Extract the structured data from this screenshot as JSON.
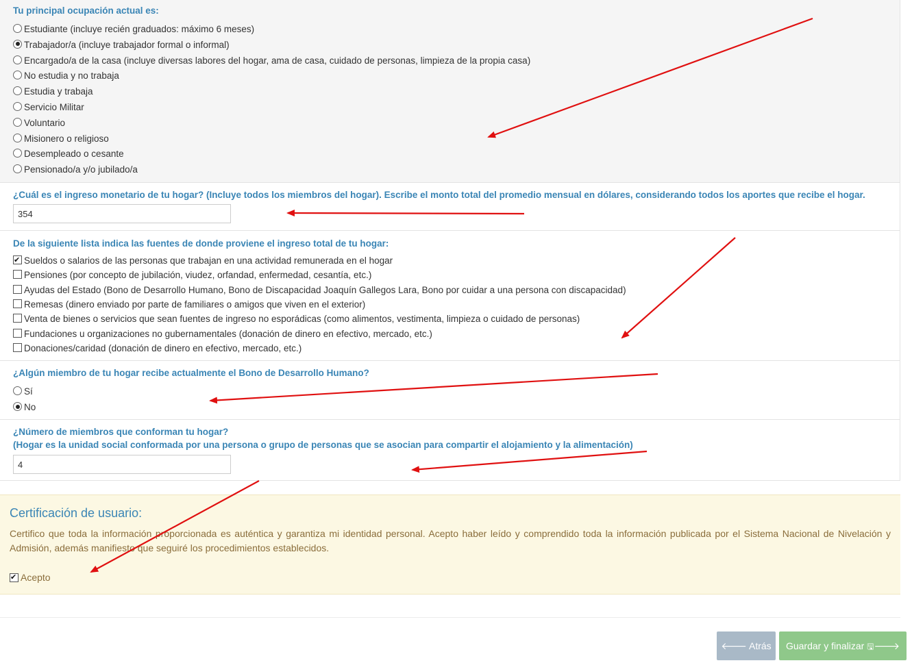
{
  "occupation": {
    "title": "Tu principal ocupación actual es:",
    "options": [
      {
        "label": "Estudiante (incluye recién graduados: máximo 6 meses)",
        "selected": false
      },
      {
        "label": "Trabajador/a (incluye trabajador formal o informal)",
        "selected": true
      },
      {
        "label": "Encargado/a de la casa (incluye diversas labores del hogar, ama de casa, cuidado de personas, limpieza de la propia casa)",
        "selected": false
      },
      {
        "label": "No estudia y no trabaja",
        "selected": false
      },
      {
        "label": "Estudia y trabaja",
        "selected": false
      },
      {
        "label": "Servicio Militar",
        "selected": false
      },
      {
        "label": "Voluntario",
        "selected": false
      },
      {
        "label": "Misionero o religioso",
        "selected": false
      },
      {
        "label": "Desempleado o cesante",
        "selected": false
      },
      {
        "label": "Pensionado/a y/o jubilado/a",
        "selected": false
      }
    ]
  },
  "income": {
    "title": "¿Cuál es el ingreso monetario de tu hogar? (Incluye todos los miembros del hogar). Escribe el monto total del promedio mensual en dólares, considerando todos los aportes que recibe el hogar.",
    "value": "354"
  },
  "sources": {
    "title": "De la siguiente lista indica las fuentes de donde proviene el ingreso total de tu hogar:",
    "options": [
      {
        "label": "Sueldos o salarios de las personas que trabajan en una actividad remunerada en el hogar",
        "checked": true
      },
      {
        "label": "Pensiones (por concepto de jubilación, viudez, orfandad, enfermedad, cesantía, etc.)",
        "checked": false
      },
      {
        "label": "Ayudas del Estado (Bono de Desarrollo Humano, Bono de Discapacidad Joaquín Gallegos Lara, Bono por cuidar a una persona con discapacidad)",
        "checked": false
      },
      {
        "label": "Remesas (dinero enviado por parte de familiares o amigos que viven en el exterior)",
        "checked": false
      },
      {
        "label": "Venta de bienes o servicios que sean fuentes de ingreso no esporádicas (como alimentos, vestimenta, limpieza o cuidado de personas)",
        "checked": false
      },
      {
        "label": "Fundaciones u organizaciones no gubernamentales (donación de dinero en efectivo, mercado, etc.)",
        "checked": false
      },
      {
        "label": "Donaciones/caridad (donación de dinero en efectivo, mercado, etc.)",
        "checked": false
      }
    ]
  },
  "bono": {
    "title": "¿Algún miembro de tu hogar recibe actualmente el Bono de Desarrollo Humano?",
    "options": [
      {
        "label": "Sí",
        "selected": false
      },
      {
        "label": "No",
        "selected": true
      }
    ]
  },
  "members": {
    "title_line1": "¿Número de miembros que conforman tu hogar?",
    "title_line2": "(Hogar es la unidad social conformada por una persona o grupo de personas que se asocian para compartir el alojamiento y la alimentación)",
    "value": "4"
  },
  "certification": {
    "title": "Certificación de usuario:",
    "text": "Certifico que toda la información proporcionada es auténtica y garantiza mi identidad personal. Acepto haber leído y comprendido toda la información publicada por el Sistema Nacional de Nivelación y Admisión, además manifiesto que seguiré los procedimientos establecidos.",
    "accept_label": "Acepto",
    "accepted": true
  },
  "buttons": {
    "back_label": "Atrás",
    "save_label": "Guardar y finalizar"
  },
  "colors": {
    "question_title": "#3a85b5",
    "cert_bg": "#fcf8e3",
    "cert_text": "#8a6d3b",
    "btn_back": "#a9b9c7",
    "btn_save": "#8fc88a",
    "annotation_arrow": "#e01010"
  }
}
